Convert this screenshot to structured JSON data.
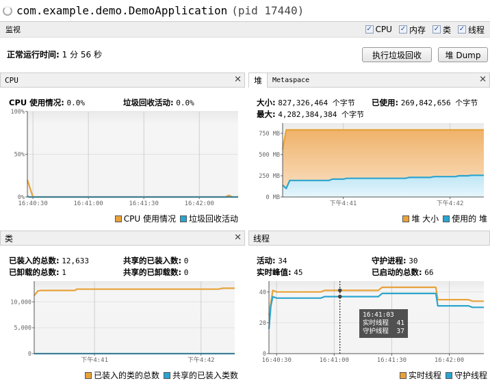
{
  "window": {
    "app_name": "com.example.demo.DemoApplication",
    "pid": "(pid 17440)",
    "spinner_icon": "loading-spinner-icon"
  },
  "monitor": {
    "label": "监视",
    "checkboxes": [
      {
        "label": "CPU",
        "checked": true
      },
      {
        "label": "内存",
        "checked": true
      },
      {
        "label": "类",
        "checked": true
      },
      {
        "label": "线程",
        "checked": true
      }
    ]
  },
  "uptime": {
    "label": "正常运行时间:",
    "value": "1 分 56 秒"
  },
  "buttons": {
    "gc": "执行垃圾回收",
    "heap_dump": "堆 Dump"
  },
  "colors": {
    "orange": "#e8a23a",
    "blue": "#2ba4cf"
  },
  "cpu": {
    "title": "CPU",
    "usage_label": "CPU 使用情况:",
    "usage_value": "0.0%",
    "gc_label": "垃圾回收活动:",
    "gc_value": "0.0%"
  },
  "heap": {
    "tabs": [
      "堆",
      "Metaspace"
    ],
    "size_label": "大小:",
    "size_value": "827,326,464 个字节",
    "used_label": "已使用:",
    "used_value": "269,842,656 个字节",
    "max_label": "最大:",
    "max_value": "4,282,384,384 个字节"
  },
  "classes": {
    "title": "类",
    "loaded_label": "已装入的总数:",
    "loaded_value": "12,633",
    "shared_loaded_label": "共享的已装入数:",
    "shared_loaded_value": "0",
    "unloaded_label": "已卸载的总数:",
    "unloaded_value": "1",
    "shared_unloaded_label": "共享的已卸载数:",
    "shared_unloaded_value": "0"
  },
  "threads": {
    "title": "线程",
    "live_label": "活动:",
    "live_value": "34",
    "daemon_label": "守护进程:",
    "daemon_value": "30",
    "peak_label": "实时峰值:",
    "peak_value": "45",
    "started_label": "已启动的总数:",
    "started_value": "66",
    "tooltip": {
      "time": "16:41:03",
      "rows": [
        {
          "label": "实时线程",
          "value": "41"
        },
        {
          "label": "守护线程",
          "value": "37"
        }
      ]
    }
  },
  "chart_data": [
    {
      "id": "cpu",
      "type": "line",
      "xrange": [
        "16:40:27",
        "16:42:21"
      ],
      "ylim": [
        0,
        100
      ],
      "yticks": [
        {
          "v": 0,
          "label": "0%"
        },
        {
          "v": 50,
          "label": "50%"
        },
        {
          "v": 100,
          "label": "100%"
        }
      ],
      "xticks": [
        {
          "t": "16:40:30",
          "label": "16:40:30"
        },
        {
          "t": "16:41:00",
          "label": "16:41:00"
        },
        {
          "t": "16:41:30",
          "label": "16:41:30"
        },
        {
          "t": "16:42:00",
          "label": "16:42:00"
        }
      ],
      "series": [
        {
          "name": "CPU 使用情况",
          "color": "#e8a23a",
          "fill": false,
          "points": [
            [
              "16:40:27",
              20
            ],
            [
              "16:40:30",
              0
            ],
            [
              "16:42:14",
              0
            ],
            [
              "16:42:16",
              2
            ],
            [
              "16:42:18",
              0
            ],
            [
              "16:42:21",
              0
            ]
          ]
        },
        {
          "name": "垃圾回收活动",
          "color": "#2ba4cf",
          "fill": false,
          "points": [
            [
              "16:40:27",
              1
            ],
            [
              "16:40:28",
              0
            ],
            [
              "16:42:21",
              0
            ]
          ]
        }
      ]
    },
    {
      "id": "heap",
      "type": "area",
      "xrange": [
        "16:40:26",
        "16:42:19"
      ],
      "ylim": [
        0,
        870
      ],
      "yticks": [
        {
          "v": 0,
          "label": "0 MB"
        },
        {
          "v": 250,
          "label": "250 MB"
        },
        {
          "v": 500,
          "label": "500 MB"
        },
        {
          "v": 750,
          "label": "750 MB"
        }
      ],
      "xticks": [
        {
          "t": "16:41:00",
          "label": "下午4:41"
        },
        {
          "t": "16:42:00",
          "label": "下午4:42"
        }
      ],
      "series": [
        {
          "name": "堆 大小",
          "color": "#e8a23a",
          "fill": true,
          "points": [
            [
              "16:40:26",
              560
            ],
            [
              "16:40:28",
              790
            ],
            [
              "16:42:19",
              790
            ]
          ]
        },
        {
          "name": "使用的 堆",
          "color": "#2ba4cf",
          "fill": true,
          "points": [
            [
              "16:40:26",
              140
            ],
            [
              "16:40:28",
              100
            ],
            [
              "16:40:30",
              195
            ],
            [
              "16:40:52",
              195
            ],
            [
              "16:40:54",
              210
            ],
            [
              "16:41:00",
              210
            ],
            [
              "16:41:02",
              220
            ],
            [
              "16:41:35",
              220
            ],
            [
              "16:41:37",
              230
            ],
            [
              "16:41:49",
              230
            ],
            [
              "16:41:51",
              240
            ],
            [
              "16:42:03",
              240
            ],
            [
              "16:42:05",
              250
            ],
            [
              "16:42:10",
              250
            ],
            [
              "16:42:12",
              255
            ],
            [
              "16:42:19",
              255
            ]
          ]
        }
      ]
    },
    {
      "id": "classes",
      "type": "line",
      "xrange": [
        "16:40:26",
        "16:42:19"
      ],
      "ylim": [
        0,
        14000
      ],
      "yticks": [
        {
          "v": 0,
          "label": "0"
        },
        {
          "v": 5000,
          "label": "5,000"
        },
        {
          "v": 10000,
          "label": "10,000"
        }
      ],
      "xticks": [
        {
          "t": "16:41:00",
          "label": "下午4:41"
        },
        {
          "t": "16:42:00",
          "label": "下午4:42"
        }
      ],
      "series": [
        {
          "name": "已装入的类的总数",
          "color": "#e8a23a",
          "fill": false,
          "points": [
            [
              "16:40:26",
              11200
            ],
            [
              "16:40:28",
              12100
            ],
            [
              "16:40:30",
              12200
            ],
            [
              "16:40:49",
              12200
            ],
            [
              "16:40:50",
              12450
            ],
            [
              "16:42:10",
              12450
            ],
            [
              "16:42:12",
              12630
            ],
            [
              "16:42:19",
              12630
            ]
          ]
        },
        {
          "name": "共享的已装入类数",
          "color": "#2ba4cf",
          "fill": false,
          "points": [
            [
              "16:40:26",
              0
            ],
            [
              "16:42:19",
              0
            ]
          ]
        }
      ]
    },
    {
      "id": "threads",
      "type": "line",
      "xrange": [
        "16:40:26",
        "16:42:18"
      ],
      "ylim": [
        0,
        47
      ],
      "yticks": [
        {
          "v": 0,
          "label": "0"
        },
        {
          "v": 20,
          "label": "20"
        },
        {
          "v": 40,
          "label": "40"
        }
      ],
      "xticks": [
        {
          "t": "16:40:30",
          "label": "16:40:30"
        },
        {
          "t": "16:41:00",
          "label": "16:41:00"
        },
        {
          "t": "16:41:30",
          "label": "16:41:30"
        },
        {
          "t": "16:42:00",
          "label": "16:42:00"
        }
      ],
      "series": [
        {
          "name": "实时线程",
          "color": "#e8a23a",
          "fill": false,
          "points": [
            [
              "16:40:26",
              25
            ],
            [
              "16:40:28",
              41
            ],
            [
              "16:40:30",
              40
            ],
            [
              "16:40:53",
              40
            ],
            [
              "16:40:55",
              41
            ],
            [
              "16:41:23",
              41
            ],
            [
              "16:41:25",
              43
            ],
            [
              "16:41:53",
              43
            ],
            [
              "16:41:54",
              35
            ],
            [
              "16:42:10",
              35
            ],
            [
              "16:42:12",
              34
            ],
            [
              "16:42:18",
              34
            ]
          ]
        },
        {
          "name": "守护线程",
          "color": "#2ba4cf",
          "fill": false,
          "points": [
            [
              "16:40:26",
              16
            ],
            [
              "16:40:27",
              31
            ],
            [
              "16:40:28",
              37
            ],
            [
              "16:40:30",
              36
            ],
            [
              "16:40:53",
              36
            ],
            [
              "16:40:55",
              37
            ],
            [
              "16:41:23",
              37
            ],
            [
              "16:41:25",
              39
            ],
            [
              "16:41:53",
              39
            ],
            [
              "16:41:54",
              31
            ],
            [
              "16:42:10",
              31
            ],
            [
              "16:42:12",
              30
            ],
            [
              "16:42:18",
              30
            ]
          ]
        }
      ],
      "crosshair": "16:41:03"
    }
  ]
}
